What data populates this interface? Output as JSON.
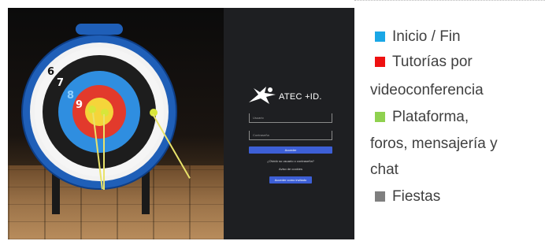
{
  "photo": {
    "ring_numbers": [
      "6",
      "7",
      "8",
      "9"
    ],
    "colors": {
      "ring_6": "#111111",
      "ring_7": "#ffffff",
      "ring_8": "#8fd0ff",
      "ring_9": "#ffffff"
    }
  },
  "login_screen": {
    "logo_text": "ATEC +ID.",
    "username_placeholder": "Usuario",
    "password_placeholder": "Contraseña",
    "login_button": "Acceder",
    "link_forgot": "¿Olvidó su usuario o contraseña?",
    "link_cookies": "Aviso de cookies",
    "guest_button": "Acceder como invitado",
    "colors": {
      "background": "#1e1f22",
      "button": "#3d5fd6"
    }
  },
  "legend": {
    "items": [
      {
        "label": "Inicio / Fin",
        "color": "#1aa7e6",
        "lines": [
          "Inicio / Fin"
        ]
      },
      {
        "label": "Tutorías por videoconferencia",
        "color": "#ee1111",
        "lines": [
          "Tutorías por",
          "videoconferencia"
        ]
      },
      {
        "label": "Plataforma, foros, mensajería y chat",
        "color": "#8fd14f",
        "lines": [
          "Plataforma,",
          "foros, mensajería y",
          "chat"
        ]
      },
      {
        "label": "Fiestas",
        "color": "#7f7f7f",
        "lines": [
          "Fiestas"
        ]
      }
    ]
  }
}
